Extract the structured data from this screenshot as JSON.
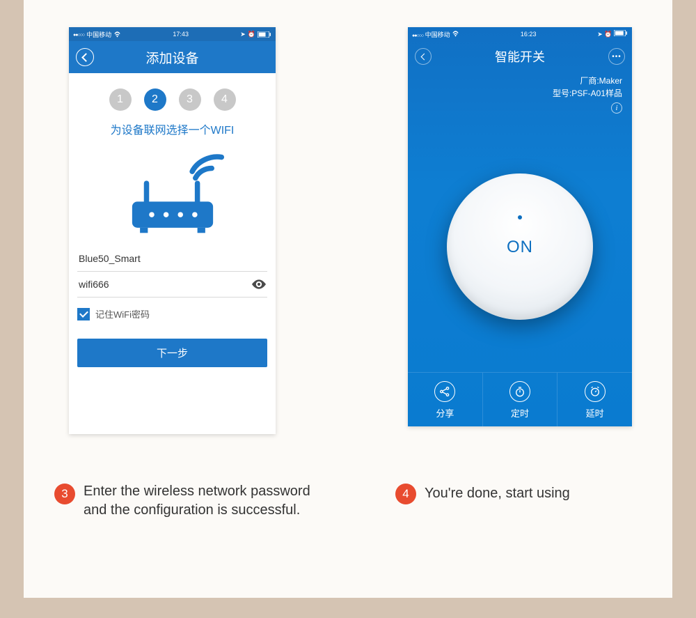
{
  "phone1": {
    "status": {
      "carrier": "中国移动",
      "time": "17:43"
    },
    "nav_title": "添加设备",
    "steps": [
      "1",
      "2",
      "3",
      "4"
    ],
    "active_step_index": 1,
    "subtitle": "为设备联网选择一个WIFI",
    "ssid_value": "Blue50_Smart",
    "password_value": "wifi666",
    "remember_label": "记住WiFi密码",
    "next_label": "下一步"
  },
  "phone2": {
    "status": {
      "carrier": "中国移动",
      "time": "16:23"
    },
    "nav_title": "智能开关",
    "vendor_label": "厂商:Maker",
    "model_label": "型号:PSF-A01样品",
    "dial_label": "ON",
    "actions": [
      {
        "label": "分享"
      },
      {
        "label": "定时"
      },
      {
        "label": "延时"
      }
    ]
  },
  "captions": {
    "step3_num": "3",
    "step3_text": "Enter the wireless network password and the configuration is successful.",
    "step4_num": "4",
    "step4_text": "You're done, start using"
  }
}
